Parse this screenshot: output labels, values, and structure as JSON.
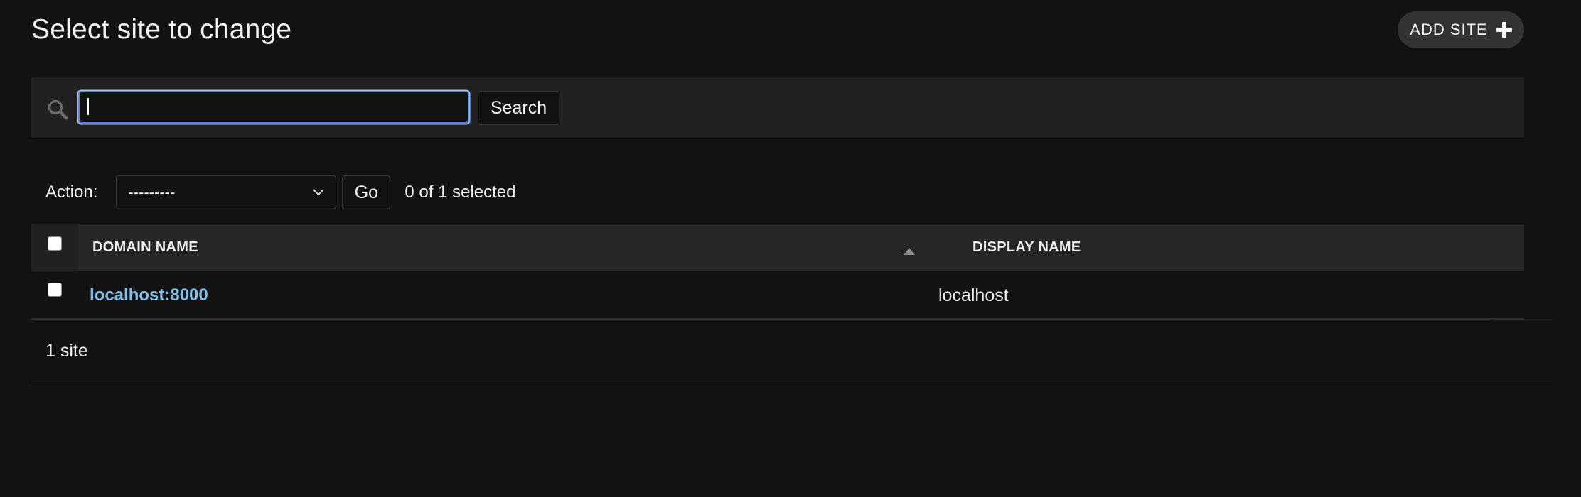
{
  "header": {
    "title": "Select site to change",
    "add_button_label": "ADD SITE",
    "add_icon": "plus-icon"
  },
  "search": {
    "value": "",
    "placeholder": "",
    "button_label": "Search",
    "icon": "search-icon"
  },
  "actions": {
    "label": "Action:",
    "selected_option": "---------",
    "go_label": "Go",
    "counter": "0 of 1 selected"
  },
  "table": {
    "columns": [
      "DOMAIN NAME",
      "DISPLAY NAME"
    ],
    "sort_icon": "sort-ascending-icon",
    "rows": [
      {
        "domain": "localhost:8000",
        "display_name": "localhost"
      }
    ]
  },
  "paginator": {
    "text": "1 site"
  },
  "colors": {
    "background": "#121212",
    "link": "#80bfe8",
    "focus_border": "#5b86d6"
  }
}
